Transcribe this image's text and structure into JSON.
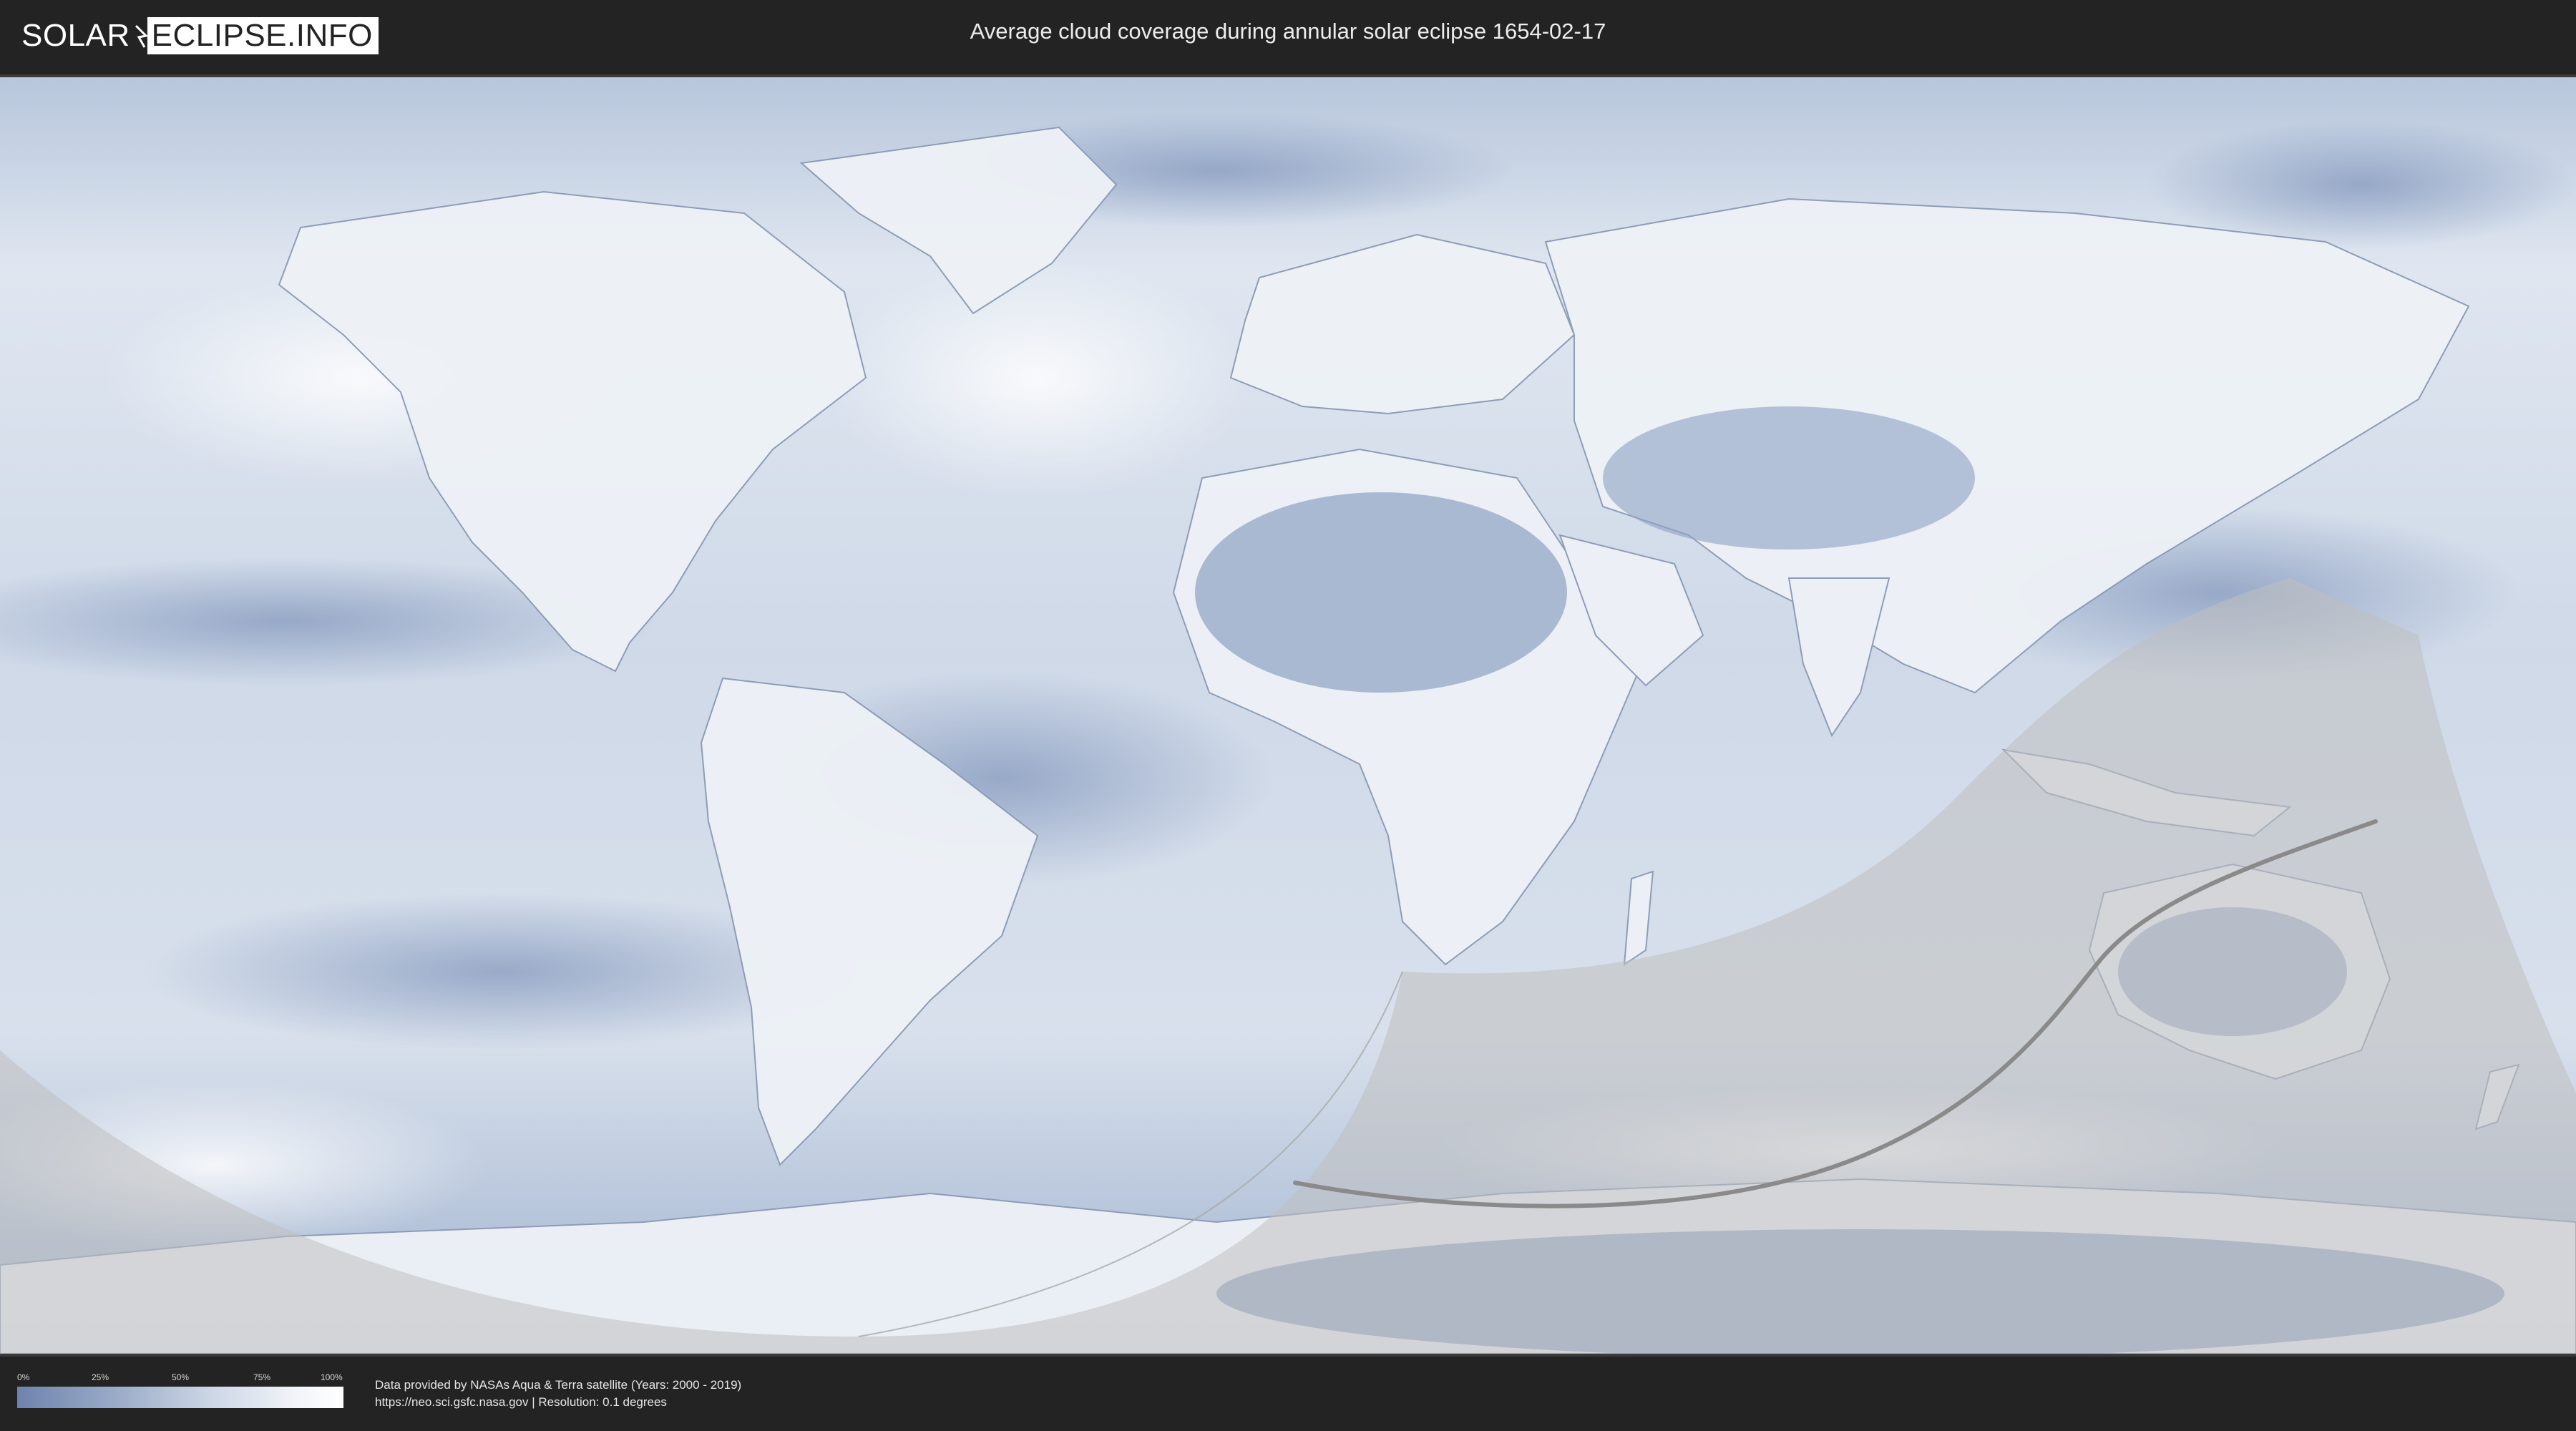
{
  "header": {
    "logo_left": "SOLAR",
    "logo_right": "ECLIPSE.INFO",
    "title": "Average cloud coverage during annular solar eclipse 1654-02-17"
  },
  "map": {
    "ocean_color": "#c9d5e6",
    "land_color": "#eef2f7",
    "cloud_dark_color": "#6f86b0",
    "eclipse_shade_color": "#bfbfbf",
    "central_path_color": "#8a8a8a"
  },
  "legend": {
    "ticks": [
      "0%",
      "25%",
      "50%",
      "75%",
      "100%"
    ],
    "gradient_start": "#6e84ad",
    "gradient_end": "#ffffff"
  },
  "credits": {
    "line1": "Data provided by NASAs Aqua & Terra satellite (Years: 2000 - 2019)",
    "line2": "https://neo.sci.gsfc.nasa.gov | Resolution: 0.1 degrees"
  }
}
